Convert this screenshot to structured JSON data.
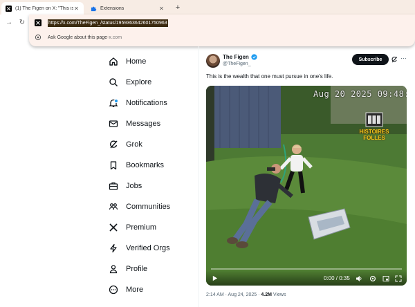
{
  "tabs": [
    {
      "title": "(1) The Figen on X: \"This is the",
      "icon": "x-logo"
    },
    {
      "title": "Extensions",
      "icon": "puzzle-icon"
    }
  ],
  "omnibox": {
    "url": "https://x.com/TheFigen_/status/1959363642601750963",
    "suggestion": "Ask Google about this page",
    "suggestion_sep": " - ",
    "suggestion_domain": "x.com"
  },
  "nav": [
    {
      "label": "Home",
      "icon": "home-icon"
    },
    {
      "label": "Explore",
      "icon": "search-icon"
    },
    {
      "label": "Notifications",
      "icon": "bell-icon"
    },
    {
      "label": "Messages",
      "icon": "mail-icon"
    },
    {
      "label": "Grok",
      "icon": "grok-icon"
    },
    {
      "label": "Bookmarks",
      "icon": "bookmark-icon"
    },
    {
      "label": "Jobs",
      "icon": "briefcase-icon"
    },
    {
      "label": "Communities",
      "icon": "people-icon"
    },
    {
      "label": "Premium",
      "icon": "x-logo-icon"
    },
    {
      "label": "Verified Orgs",
      "icon": "lightning-icon"
    },
    {
      "label": "Profile",
      "icon": "person-icon"
    },
    {
      "label": "More",
      "icon": "more-circle-icon"
    }
  ],
  "post": {
    "author": "The Figen",
    "handle": "@TheFigen_",
    "subscribe": "Subscribe",
    "text": "This is the wealth that one must pursue in one's life.",
    "video_timestamp": "Aug 20 2025  09:48:",
    "watermark": "HISTOIRES FOLLES",
    "video_time": "0:00 / 0:35",
    "meta_time": "2:14 AM · Aug 24, 2025 · ",
    "views_count": "4.2M",
    "views_label": " Views"
  },
  "colors": {
    "accent": "#1d9bf0",
    "tabstrip": "#f7ece4",
    "omnibox": "#fdf1ec"
  }
}
